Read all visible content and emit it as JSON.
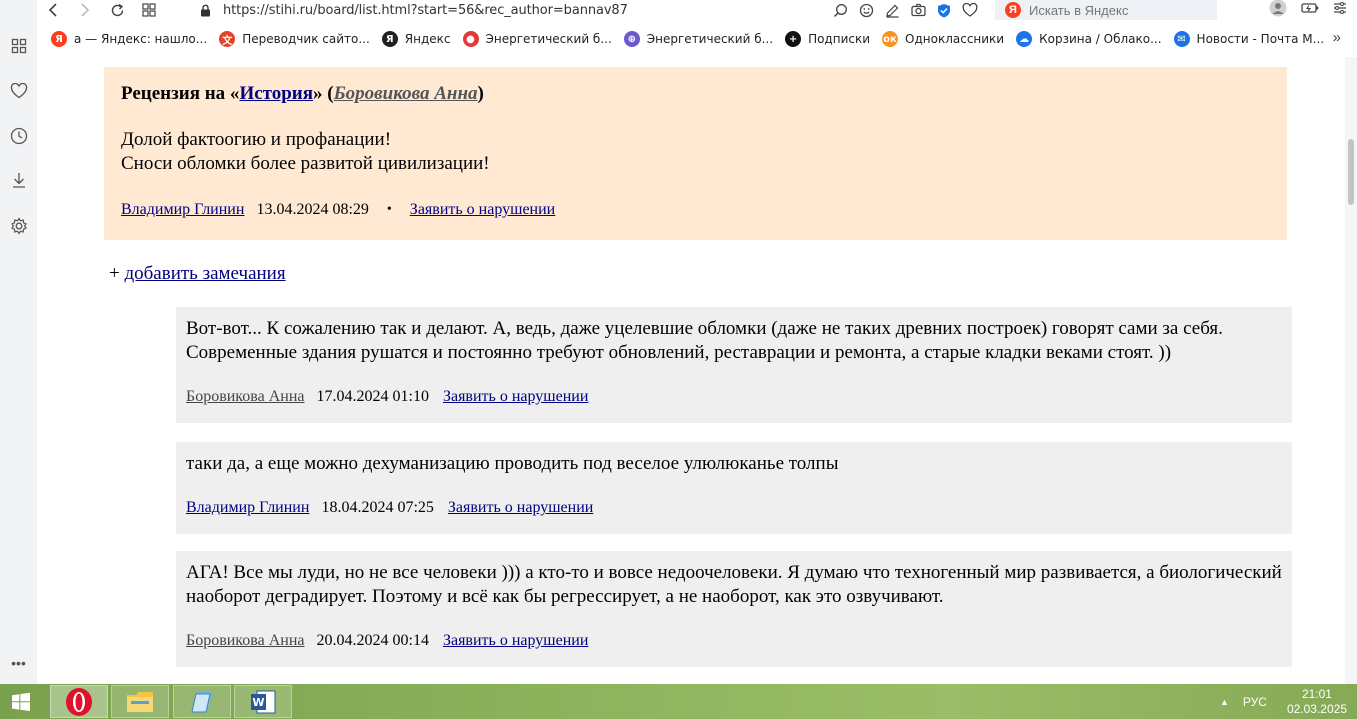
{
  "browser": {
    "url": "https://stihi.ru/board/list.html?start=56&rec_author=bannav87",
    "search_placeholder": "Искать в Яндекс",
    "bookmarks": [
      {
        "label": "а — Яндекс: нашло...",
        "color": "#fc3f1d",
        "glyph": "Я"
      },
      {
        "label": "Переводчик сайто...",
        "color": "#e0452a",
        "glyph": "文"
      },
      {
        "label": "Яндекс",
        "color": "#222222",
        "glyph": "Я"
      },
      {
        "label": "Энергетический б...",
        "color": "#e53935",
        "glyph": "●"
      },
      {
        "label": "Энергетический б...",
        "color": "#6a5acd",
        "glyph": "⊕"
      },
      {
        "label": "Подписки",
        "color": "#111111",
        "glyph": "+"
      },
      {
        "label": "Одноклассники",
        "color": "#f7931e",
        "glyph": "ок"
      },
      {
        "label": "Корзина / Облако...",
        "color": "#1e73e8",
        "glyph": "☁"
      },
      {
        "label": "Новости - Почта М...",
        "color": "#1e73e8",
        "glyph": "✉"
      }
    ]
  },
  "review": {
    "title_prefix": "Рецензия на «",
    "work_title": "История",
    "title_middle": "» (",
    "work_author": "Боровикова Анна",
    "title_suffix": ")",
    "lines": [
      "Долой фактоогию и профанации!",
      "Сноси обломки более развитой цивилизации!"
    ],
    "author": "Владимир Глинин",
    "date": "13.04.2024 08:29",
    "separator": "•",
    "report": "Заявить о нарушении"
  },
  "add_note": {
    "plus": "+ ",
    "label": "добавить замечания"
  },
  "comments": [
    {
      "text": "Вот-вот... К сожалению так и делают. А, ведь, даже уцелевшие обломки (даже не таких древних построек) говорят сами за себя. Современные здания рушатся и постоянно требуют обновлений, реставрации и ремонта, а старые кладки веками стоят. ))",
      "author": "Боровикова Анна",
      "date": "17.04.2024 01:10",
      "report": "Заявить о нарушении"
    },
    {
      "text": "таки да, а еще можно дехуманизацию проводить под веселое улюлюканье толпы",
      "author": "Владимир Глинин",
      "date": "18.04.2024 07:25",
      "report": "Заявить о нарушении"
    },
    {
      "text": "АГА! Все мы луди, но не все человеки ))) а кто-то и вовсе недоочеловеки. Я думаю что техногенный мир развивается, а биологический наоборот деградирует. Поэтому и всё как бы регрессирует, а не наоборот, как это озвучивают.",
      "author": "Боровикова Анна",
      "date": "20.04.2024 00:14",
      "report": "Заявить о нарушении"
    }
  ],
  "taskbar": {
    "lang": "РУС",
    "time": "21:01",
    "date": "02.03.2025"
  }
}
